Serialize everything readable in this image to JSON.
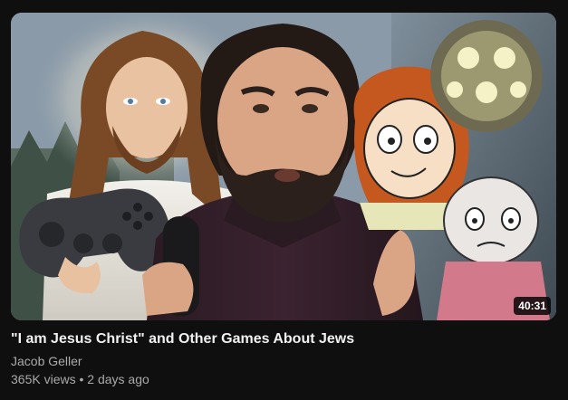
{
  "video": {
    "duration": "40:31",
    "title": "\"I am Jesus Christ\" and Other Games About Jews",
    "channel": "Jacob Geller",
    "views": "365K views",
    "separator": "•",
    "age": "2 days ago"
  },
  "colors": {
    "background": "#0f0f0f",
    "title": "#f1f1f1",
    "secondary_text": "#aaaaaa"
  }
}
